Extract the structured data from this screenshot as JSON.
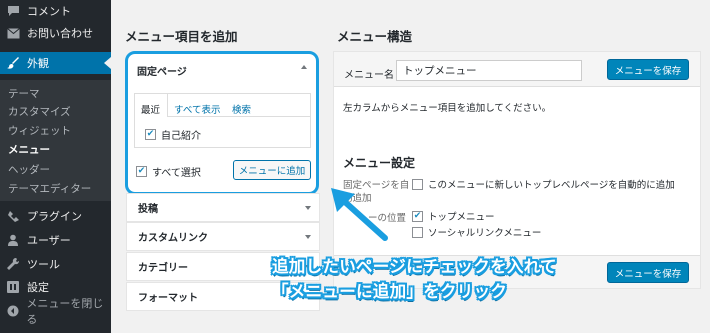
{
  "sidebar": {
    "items": [
      {
        "label": "コメント",
        "icon": "comment-icon"
      },
      {
        "label": "お問い合わせ",
        "icon": "mail-icon"
      },
      {
        "label": "外観",
        "icon": "brush-icon"
      },
      {
        "label": "プラグイン",
        "icon": "plugin-icon"
      },
      {
        "label": "ユーザー",
        "icon": "user-icon"
      },
      {
        "label": "ツール",
        "icon": "wrench-icon"
      },
      {
        "label": "設定",
        "icon": "settings-icon"
      },
      {
        "label": "メニューを閉じる",
        "icon": "collapse-icon"
      }
    ],
    "submenu": [
      "テーマ",
      "カスタマイズ",
      "ウィジェット",
      "メニュー",
      "ヘッダー",
      "テーマエディター"
    ],
    "active_color": "#0073aa"
  },
  "add_items": {
    "heading": "メニュー項目を追加",
    "fixed_page": {
      "title": "固定ページ",
      "tabs": [
        "最近",
        "すべて表示",
        "検索"
      ],
      "pages": [
        {
          "label": "自己紹介",
          "checked": true
        }
      ],
      "select_all": "すべて選択",
      "add_button": "メニューに追加"
    },
    "sections": [
      "投稿",
      "カスタムリンク",
      "カテゴリー",
      "フォーマット"
    ]
  },
  "structure": {
    "heading": "メニュー構造",
    "name_label": "メニュー名",
    "name_value": "トップメニュー",
    "save_label": "メニューを保存",
    "instructions": "左カラムからメニュー項目を追加してください。",
    "settings": {
      "title": "メニュー設定",
      "auto_add_label_line1": "固定ページを自",
      "auto_add_label_line2": "動追加",
      "auto_add_option": "このメニューに新しいトップレベルページを自動的に追加",
      "location_label": "ーの位置",
      "locations": [
        {
          "label": "トップメニュー",
          "checked": true
        },
        {
          "label": "ソーシャルリンクメニュー",
          "checked": false
        }
      ]
    }
  },
  "annotation": {
    "line1": "追加したいページにチェックを入れて",
    "line2": "「メニューに追加」をクリック",
    "color": "#1a9ee0"
  }
}
